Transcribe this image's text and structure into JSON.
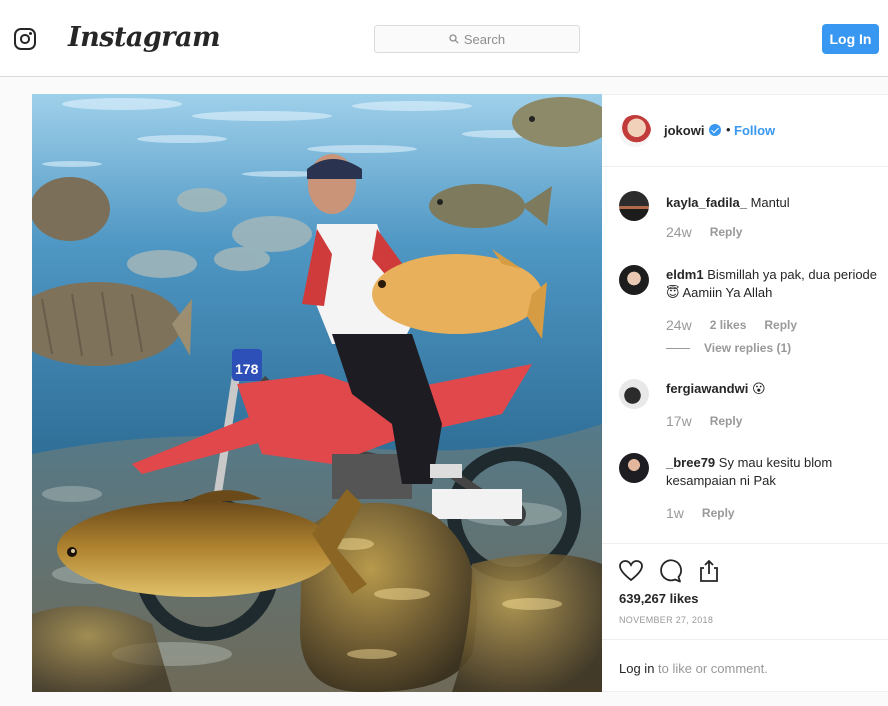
{
  "header": {
    "logo_icon": "instagram-glyph-icon",
    "wordmark": "Instagram",
    "search_placeholder": "Search",
    "login_label": "Log In",
    "accent_color": "#3897f0"
  },
  "post": {
    "image_description_icon": "underwater-motorcycle-photo",
    "author": "jokowi",
    "bullet": "•",
    "follow_label": "Follow",
    "likes": "639,267 likes",
    "date": "NOVEMBER 27, 2018"
  },
  "comments": [
    {
      "user": "kayla_fadila_",
      "text": "Mantul",
      "time": "24w",
      "reply": "Reply",
      "likes": ""
    },
    {
      "user": "eldm1",
      "text": "Bismillah ya pak, dua periode 😇 Aamiin Ya Allah",
      "time": "24w",
      "likes": "2 likes",
      "reply": "Reply",
      "view_replies": "View replies (1)"
    },
    {
      "user": "fergiawandwi",
      "text": "😮",
      "time": "17w",
      "reply": "Reply",
      "likes": ""
    },
    {
      "user": "_bree79",
      "text": "Sy mau kesitu blom kesampaian ni Pak",
      "time": "1w",
      "reply": "Reply",
      "likes": ""
    }
  ],
  "footer": {
    "login_link": "Log in",
    "login_suffix": " to like or comment."
  }
}
